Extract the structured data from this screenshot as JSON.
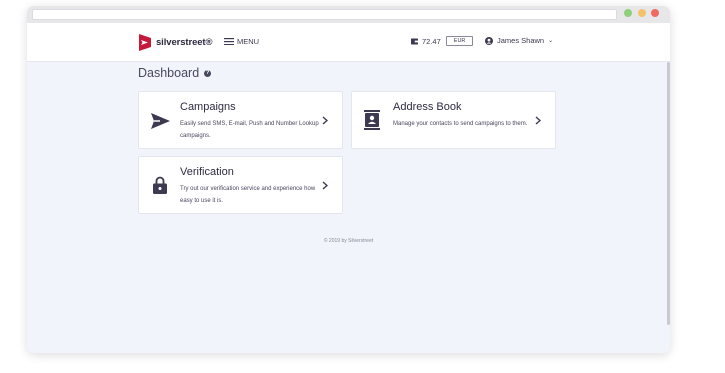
{
  "brand": {
    "name": "silverstreet®",
    "accent": "#c5183b"
  },
  "header": {
    "menu_label": "MENU",
    "balance": "72.47",
    "currency": "EUR",
    "user_name": "James Shawn",
    "user_caret": "⌄"
  },
  "page": {
    "title": "Dashboard",
    "help_glyph": "?"
  },
  "cards": [
    {
      "title": "Campaigns",
      "description": "Easily send SMS, E-mail, Push and Number Lookup campaigns.",
      "icon": "send-icon"
    },
    {
      "title": "Address Book",
      "description": "Manage your contacts to send campaigns to them.",
      "icon": "address-book-icon"
    },
    {
      "title": "Verification",
      "description": "Try out our verification service and experience how easy to use it is.",
      "icon": "lock-icon"
    }
  ],
  "footer": {
    "copyright": "© 2019 by Silverstreet"
  },
  "colors": {
    "window_bg": "#f2f4fb",
    "text_dark": "#2f2c42",
    "traffic_green": "#8fd07a",
    "traffic_yellow": "#f2c46a",
    "traffic_red": "#ee6a63"
  }
}
